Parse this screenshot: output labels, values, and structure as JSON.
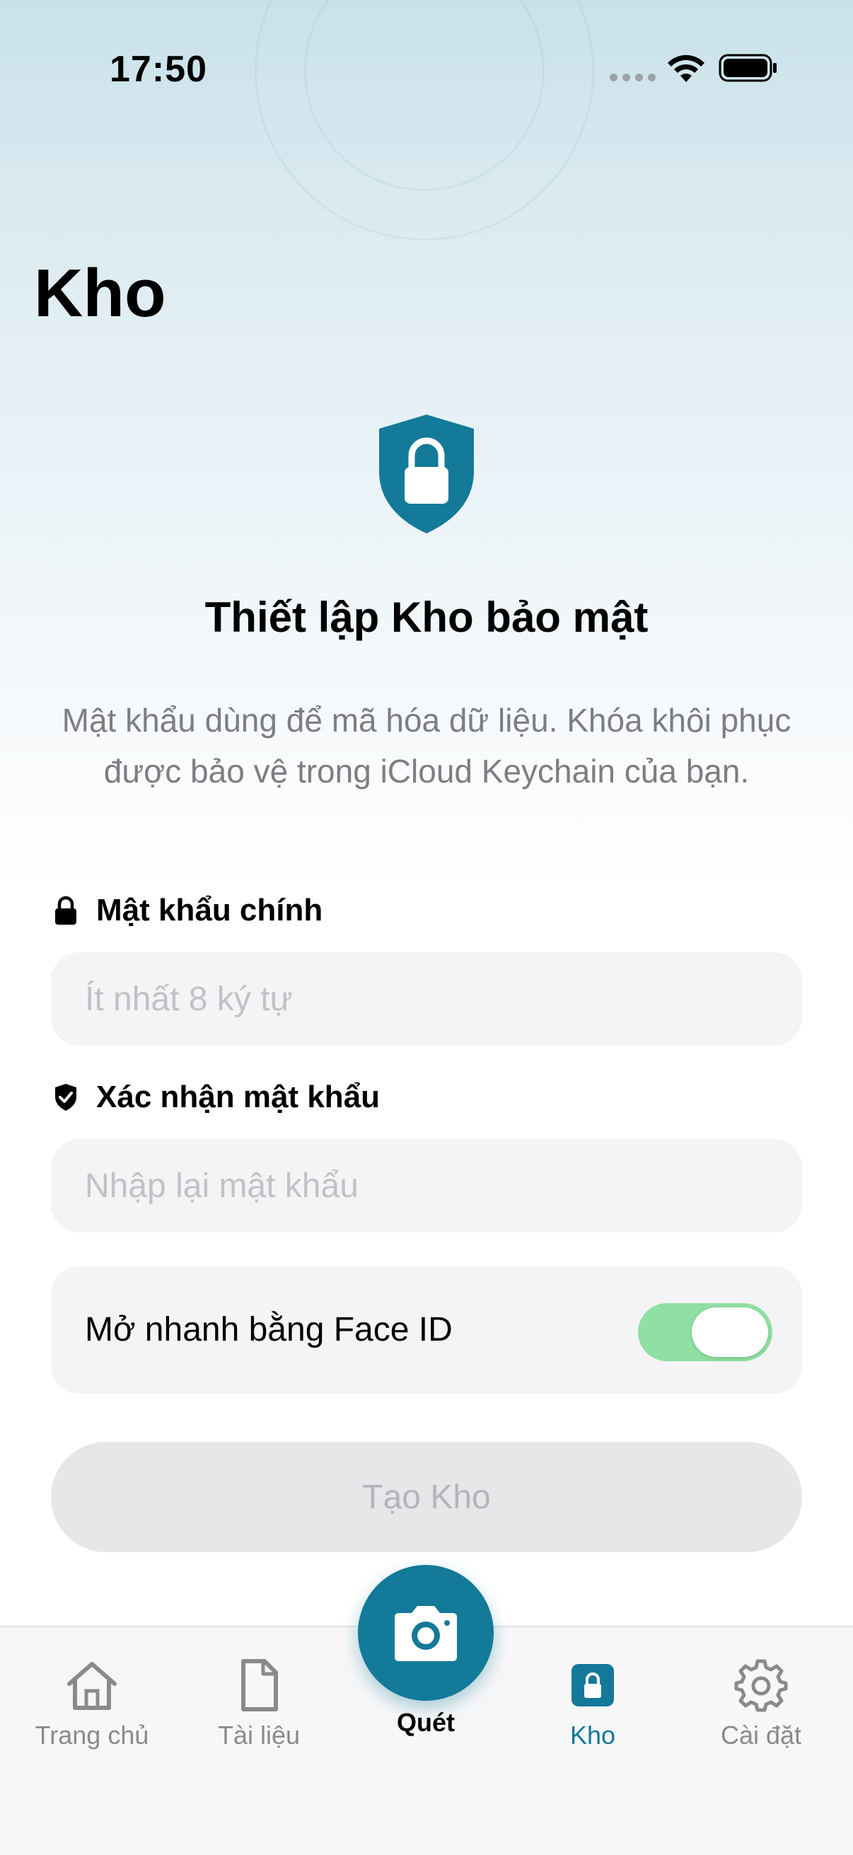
{
  "status_bar": {
    "time": "17:50",
    "signal_icon": "signal-dots-icon",
    "wifi_icon": "wifi-icon",
    "battery_icon": "battery-icon"
  },
  "header": {
    "title": "Kho"
  },
  "setup": {
    "icon": "shield-lock-icon",
    "title": "Thiết lập Kho bảo mật",
    "description": "Mật khẩu dùng để mã hóa dữ liệu. Khóa khôi phục được bảo vệ trong iCloud Keychain của bạn."
  },
  "form": {
    "master_password": {
      "label": "Mật khẩu chính",
      "icon": "lock-icon",
      "value": "",
      "placeholder": "Ít nhất 8 ký tự"
    },
    "confirm_password": {
      "label": "Xác nhận mật khẩu",
      "icon": "shield-check-icon",
      "value": "",
      "placeholder": "Nhập lại mật khẩu"
    },
    "face_id": {
      "label": "Mở nhanh bằng Face ID",
      "enabled": true
    },
    "create_button": "Tạo Kho"
  },
  "tab_bar": {
    "items": [
      {
        "label": "Trang chủ",
        "icon": "home-icon",
        "active": false
      },
      {
        "label": "Tài liệu",
        "icon": "document-icon",
        "active": false
      },
      {
        "label": "Quét",
        "icon": "camera-icon",
        "active": false
      },
      {
        "label": "Kho",
        "icon": "lock-icon",
        "active": true
      },
      {
        "label": "Cài đặt",
        "icon": "gear-icon",
        "active": false
      }
    ]
  },
  "colors": {
    "accent": "#147a99",
    "toggle_on": "#90dfa3",
    "input_bg": "#f4f4f6",
    "disabled_button": "#e7e7ea"
  }
}
